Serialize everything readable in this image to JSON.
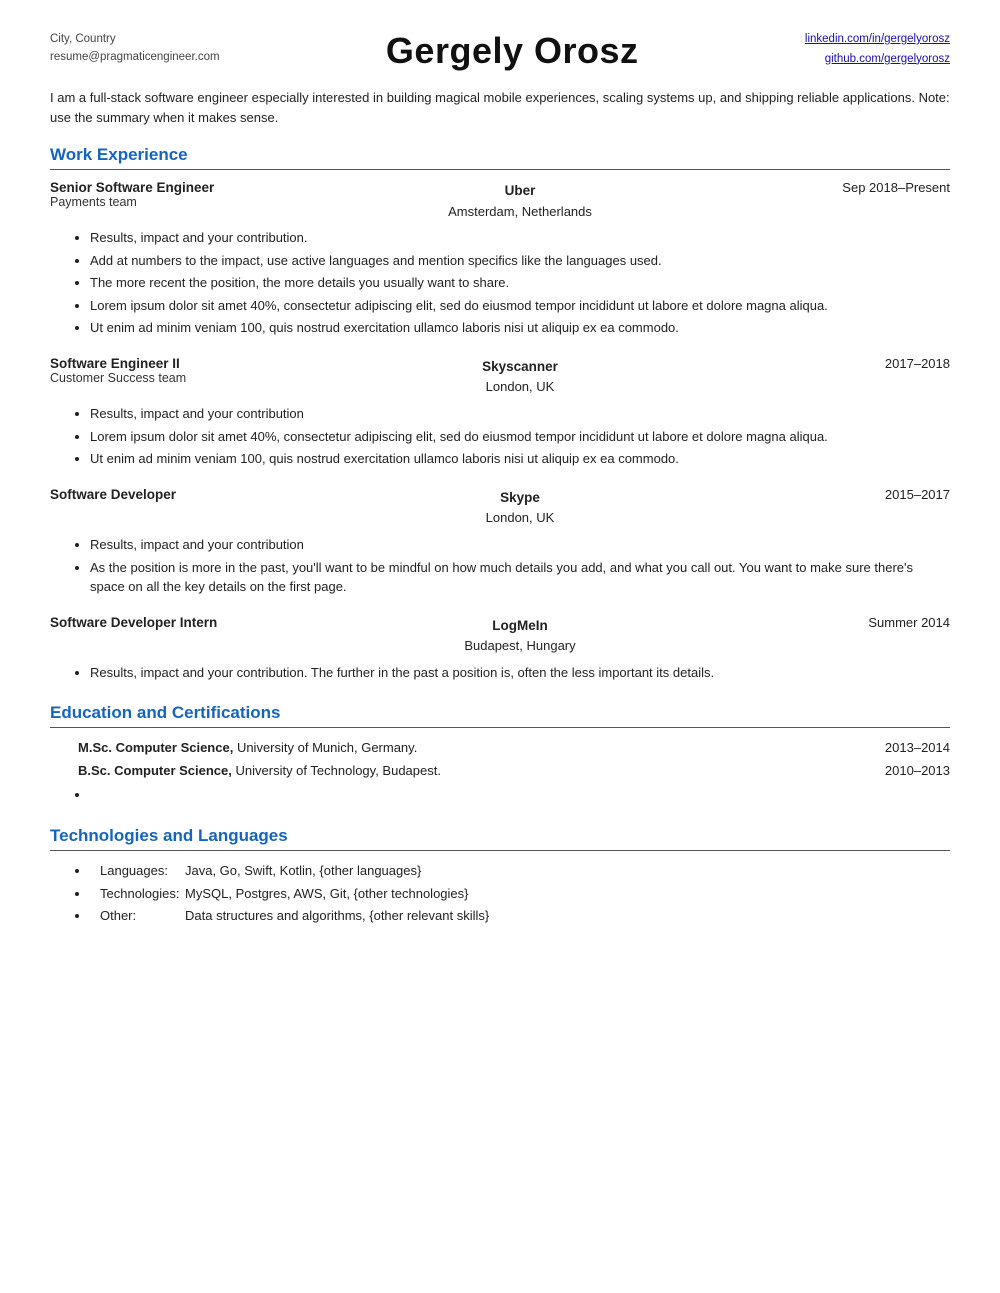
{
  "header": {
    "left": {
      "location": "City, Country",
      "email": "resume@pragmaticengineer.com"
    },
    "name": "Gergely Orosz",
    "right": {
      "linkedin": "linkedin.com/in/gergelyorosz",
      "github": "github.com/gergelyorosz"
    }
  },
  "summary": "I am a full-stack software engineer especially interested in building magical mobile experiences, scaling systems up, and shipping reliable applications. Note: use the summary when it makes sense.",
  "work_experience": {
    "section_title": "Work Experience",
    "jobs": [
      {
        "title": "Senior Software Engineer",
        "subtitle": "Payments team",
        "company": "Uber",
        "location": "Amsterdam, Netherlands",
        "date": "Sep 2018–Present",
        "bullets": [
          "Results, impact and your contribution.",
          "Add at numbers to the impact, use active languages and mention specifics like the languages used.",
          "The more recent the position, the more details you usually want to share.",
          "Lorem ipsum dolor sit amet 40%, consectetur adipiscing elit, sed do eiusmod tempor incididunt ut labore et dolore magna aliqua.",
          "Ut enim ad minim veniam 100, quis nostrud exercitation ullamco laboris nisi ut aliquip ex ea commodo."
        ]
      },
      {
        "title": "Software Engineer II",
        "subtitle": "Customer Success team",
        "company": "Skyscanner",
        "location": "London, UK",
        "date": "2017–2018",
        "bullets": [
          "Results, impact and your contribution",
          "Lorem ipsum dolor sit amet 40%, consectetur adipiscing elit, sed do eiusmod tempor incididunt ut labore et dolore magna aliqua.",
          "Ut enim ad minim veniam 100, quis nostrud exercitation ullamco laboris nisi ut aliquip ex ea commodo."
        ]
      },
      {
        "title": "Software Developer",
        "subtitle": "",
        "company": "Skype",
        "location": "London, UK",
        "date": "2015–2017",
        "bullets": [
          "Results, impact and your contribution",
          "As the position is more in the past, you'll want to be mindful on how much details you add, and what you call out. You want to make sure there's space on all the key details on the first page."
        ]
      },
      {
        "title": "Software Developer Intern",
        "subtitle": "",
        "company": "LogMeIn",
        "location": "Budapest, Hungary",
        "date": "Summer 2014",
        "bullets": [
          "Results, impact and your contribution. The further in the past a position is, often the less important its details."
        ]
      }
    ]
  },
  "education": {
    "section_title": "Education and Certifications",
    "items": [
      {
        "bold": "M.Sc. Computer Science,",
        "text": " University of Munich, Germany.",
        "year": "2013–2014"
      },
      {
        "bold": "B.Sc. Computer Science,",
        "text": " University of Technology, Budapest.",
        "year": "2010–2013"
      },
      {
        "bold": "",
        "text": "",
        "year": ""
      }
    ]
  },
  "technologies": {
    "section_title": "Technologies and Languages",
    "items": [
      {
        "label": "Languages:",
        "value": "Java, Go, Swift, Kotlin, {other languages}"
      },
      {
        "label": "Technologies:",
        "value": "MySQL, Postgres, AWS, Git, {other technologies}"
      },
      {
        "label": "Other:",
        "value": "Data structures and algorithms, {other relevant skills}"
      }
    ]
  }
}
